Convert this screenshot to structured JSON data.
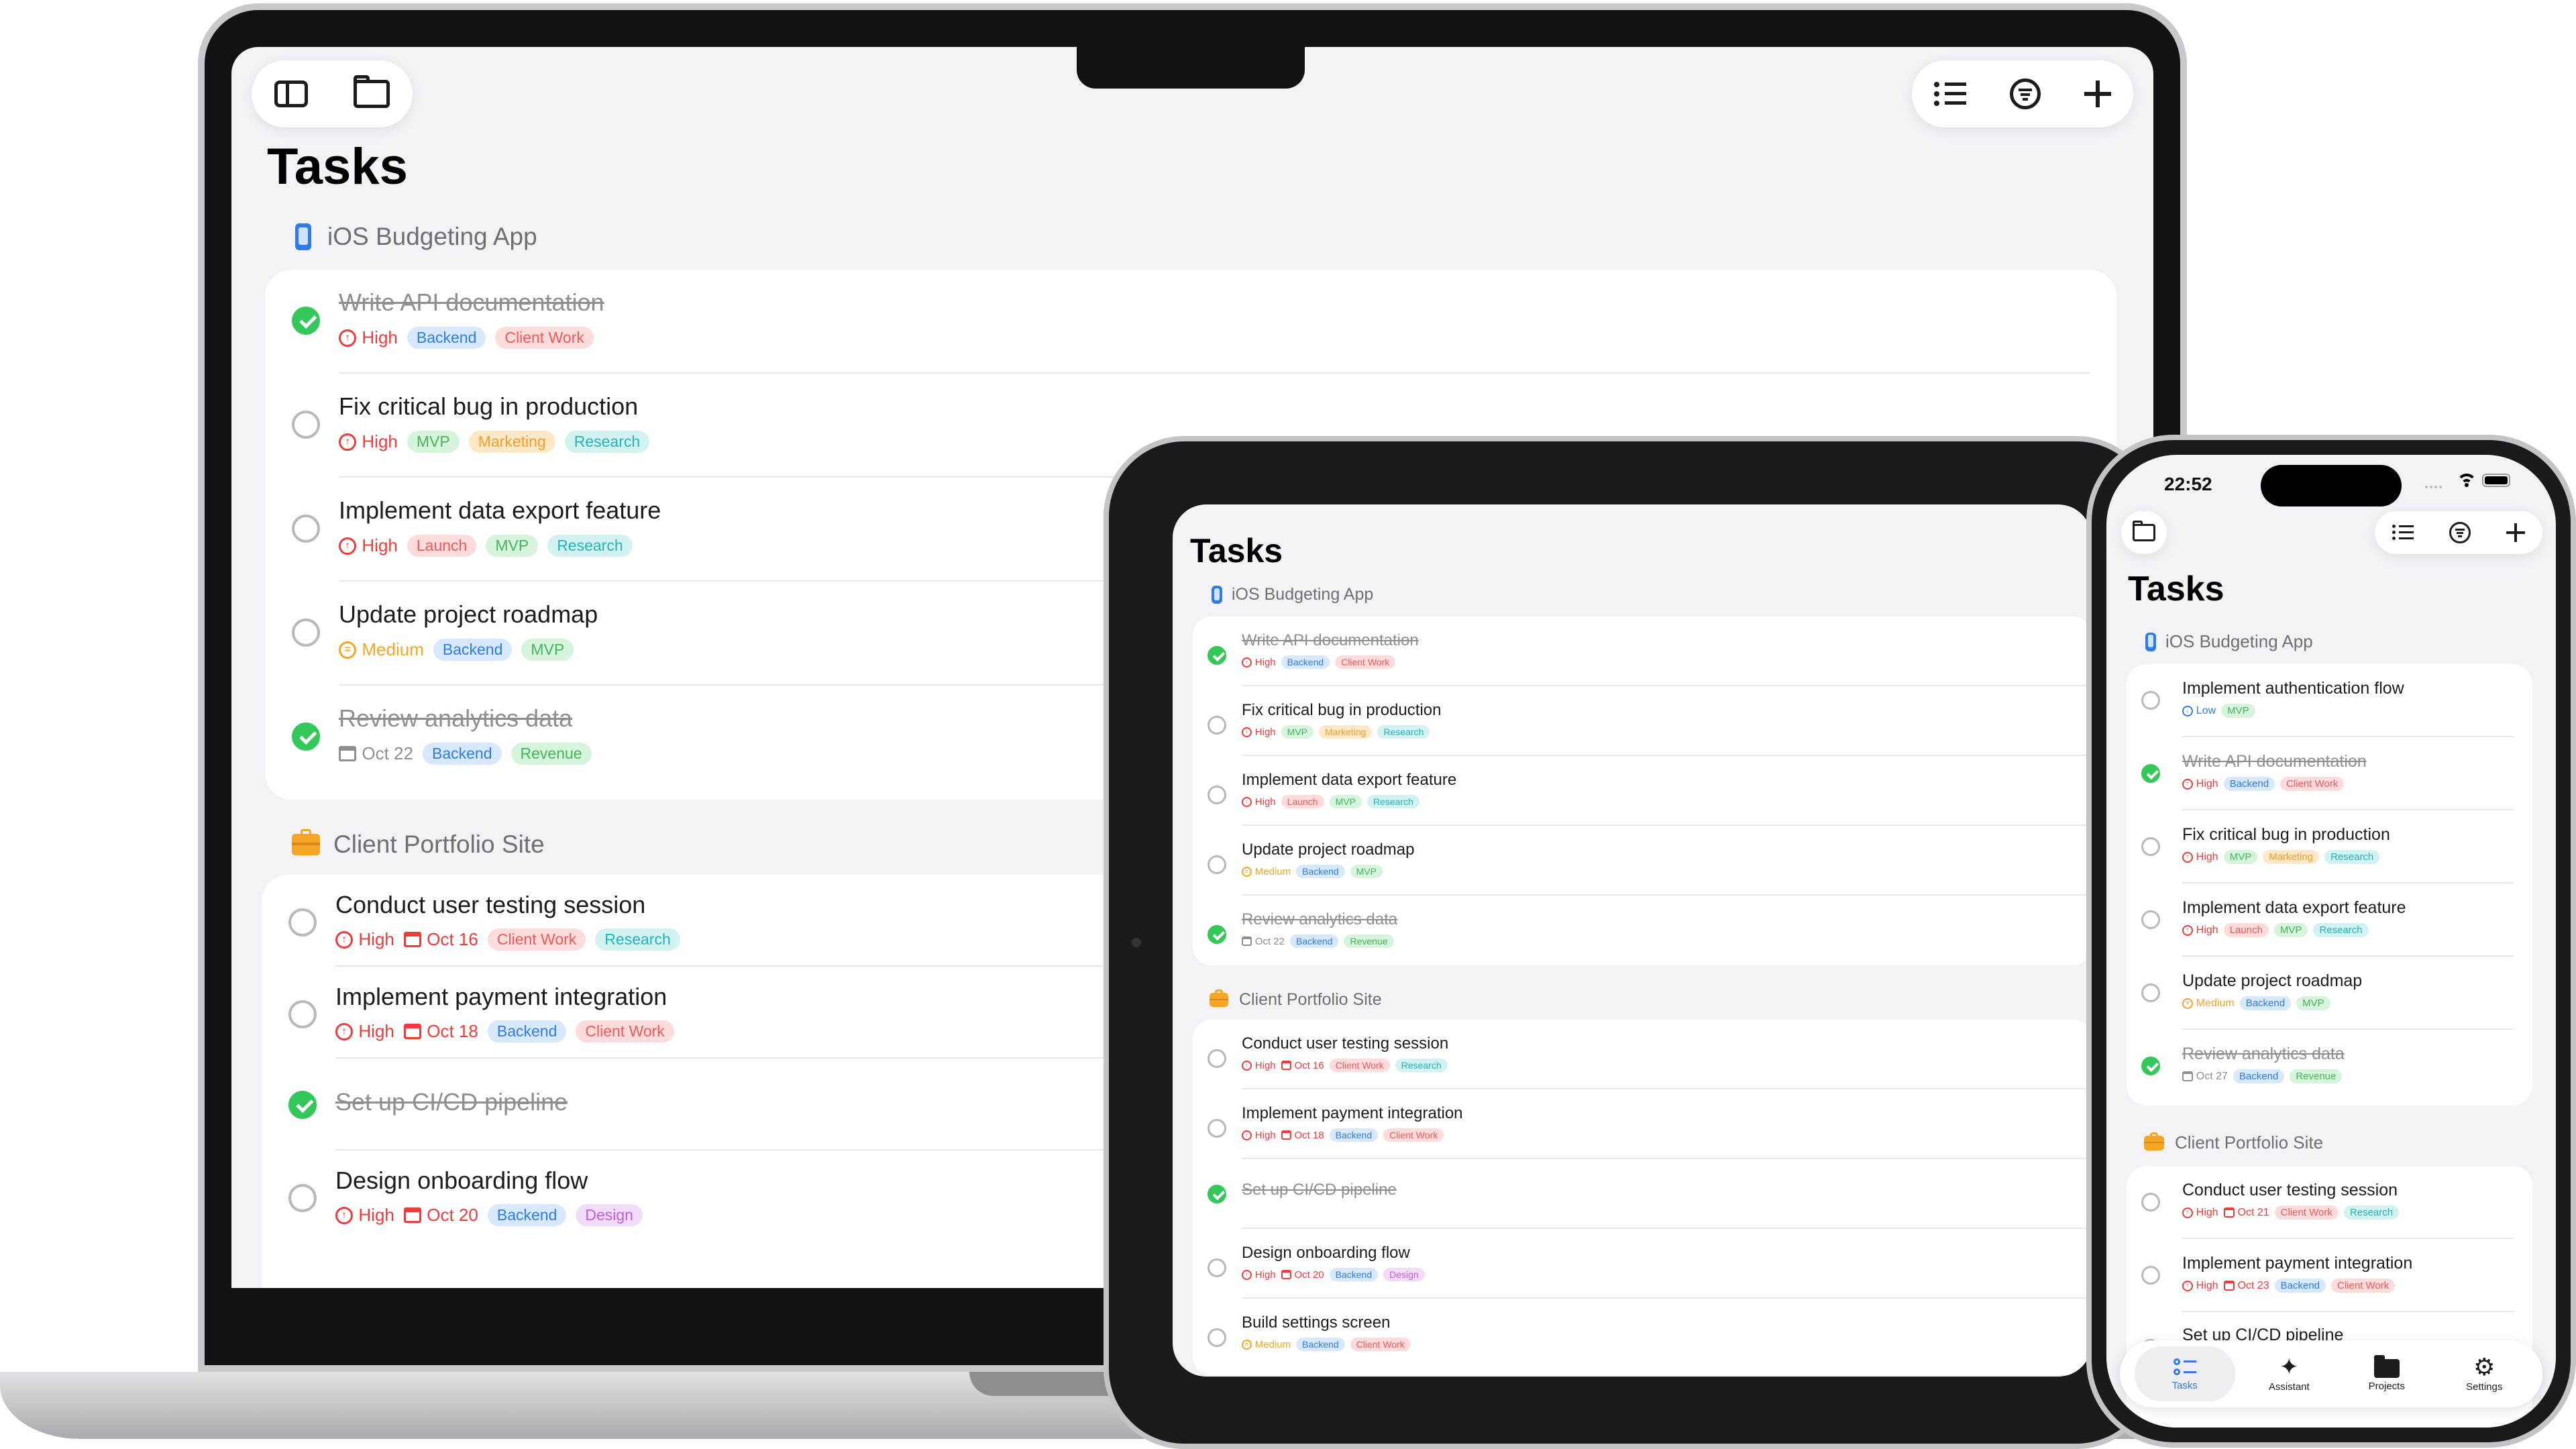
{
  "laptop": {
    "title": "Tasks",
    "toolbar_left": [
      "sidebar-icon",
      "folder-icon"
    ],
    "toolbar_right": [
      "list-icon",
      "filter-icon",
      "plus-icon"
    ],
    "sections": [
      {
        "name": "iOS Budgeting App",
        "tasks": [
          {
            "title": "Write API documentation",
            "done": true,
            "priority": "High",
            "date": "",
            "tags": [
              "Backend",
              "Client Work"
            ]
          },
          {
            "title": "Fix critical bug in production",
            "done": false,
            "priority": "High",
            "date": "",
            "tags": [
              "MVP",
              "Marketing",
              "Research"
            ]
          },
          {
            "title": "Implement data export feature",
            "done": false,
            "priority": "High",
            "date": "",
            "tags": [
              "Launch",
              "MVP",
              "Research"
            ]
          },
          {
            "title": "Update project roadmap",
            "done": false,
            "priority": "Medium",
            "date": "",
            "tags": [
              "Backend",
              "MVP"
            ]
          },
          {
            "title": "Review analytics data",
            "done": true,
            "priority": "",
            "date": "Oct 22",
            "tags": [
              "Backend",
              "Revenue"
            ]
          }
        ]
      },
      {
        "name": "Client Portfolio Site",
        "tasks": [
          {
            "title": "Conduct user testing session",
            "done": false,
            "priority": "High",
            "date": "Oct 16",
            "tags": [
              "Client Work",
              "Research"
            ]
          },
          {
            "title": "Implement payment integration",
            "done": false,
            "priority": "High",
            "date": "Oct 18",
            "tags": [
              "Backend",
              "Client Work"
            ]
          },
          {
            "title": "Set up CI/CD pipeline",
            "done": true,
            "priority": "",
            "date": "",
            "tags": []
          },
          {
            "title": "Design onboarding flow",
            "done": false,
            "priority": "High",
            "date": "Oct 20",
            "tags": [
              "Backend",
              "Design"
            ]
          }
        ]
      }
    ]
  },
  "ipad": {
    "title": "Tasks",
    "sections": [
      {
        "name": "iOS Budgeting App",
        "tasks": [
          {
            "title": "Write API documentation",
            "done": true,
            "priority": "High",
            "date": "",
            "tags": [
              "Backend",
              "Client Work"
            ]
          },
          {
            "title": "Fix critical bug in production",
            "done": false,
            "priority": "High",
            "date": "",
            "tags": [
              "MVP",
              "Marketing",
              "Research"
            ]
          },
          {
            "title": "Implement data export feature",
            "done": false,
            "priority": "High",
            "date": "",
            "tags": [
              "Launch",
              "MVP",
              "Research"
            ]
          },
          {
            "title": "Update project roadmap",
            "done": false,
            "priority": "Medium",
            "date": "",
            "tags": [
              "Backend",
              "MVP"
            ]
          },
          {
            "title": "Review analytics data",
            "done": true,
            "priority": "",
            "date": "Oct 22",
            "tags": [
              "Backend",
              "Revenue"
            ]
          }
        ]
      },
      {
        "name": "Client Portfolio Site",
        "tasks": [
          {
            "title": "Conduct user testing session",
            "done": false,
            "priority": "High",
            "date": "Oct 16",
            "tags": [
              "Client Work",
              "Research"
            ]
          },
          {
            "title": "Implement payment integration",
            "done": false,
            "priority": "High",
            "date": "Oct 18",
            "tags": [
              "Backend",
              "Client Work"
            ]
          },
          {
            "title": "Set up CI/CD pipeline",
            "done": true,
            "priority": "",
            "date": "",
            "tags": []
          },
          {
            "title": "Design onboarding flow",
            "done": false,
            "priority": "High",
            "date": "Oct 20",
            "tags": [
              "Backend",
              "Design"
            ]
          },
          {
            "title": "Build settings screen",
            "done": false,
            "priority": "Medium",
            "date": "",
            "tags": [
              "Backend",
              "Client Work"
            ]
          }
        ]
      }
    ]
  },
  "phone": {
    "time": "22:52",
    "title": "Tasks",
    "sections": [
      {
        "name": "iOS Budgeting App",
        "tasks": [
          {
            "title": "Implement authentication flow",
            "done": false,
            "priority": "Low",
            "date": "",
            "tags": [
              "MVP"
            ]
          },
          {
            "title": "Write API documentation",
            "done": true,
            "priority": "High",
            "date": "",
            "tags": [
              "Backend",
              "Client Work"
            ]
          },
          {
            "title": "Fix critical bug in production",
            "done": false,
            "priority": "High",
            "date": "",
            "tags": [
              "MVP",
              "Marketing",
              "Research"
            ]
          },
          {
            "title": "Implement data export feature",
            "done": false,
            "priority": "High",
            "date": "",
            "tags": [
              "Launch",
              "MVP",
              "Research"
            ]
          },
          {
            "title": "Update project roadmap",
            "done": false,
            "priority": "Medium",
            "date": "",
            "tags": [
              "Backend",
              "MVP"
            ]
          },
          {
            "title": "Review analytics data",
            "done": true,
            "priority": "",
            "date": "Oct 27",
            "tags": [
              "Backend",
              "Revenue"
            ]
          }
        ]
      },
      {
        "name": "Client Portfolio Site",
        "tasks": [
          {
            "title": "Conduct user testing session",
            "done": false,
            "priority": "High",
            "date": "Oct 21",
            "tags": [
              "Client Work",
              "Research"
            ]
          },
          {
            "title": "Implement payment integration",
            "done": false,
            "priority": "High",
            "date": "Oct 23",
            "tags": [
              "Backend",
              "Client Work"
            ]
          },
          {
            "title": "Set up CI/CD pipeline",
            "done": false,
            "priority": "",
            "date": "",
            "tags": []
          }
        ]
      }
    ],
    "tabs": [
      {
        "label": "Tasks",
        "icon": "checklist-icon",
        "active": true
      },
      {
        "label": "Assistant",
        "icon": "sparkle-icon",
        "active": false
      },
      {
        "label": "Projects",
        "icon": "folder-icon",
        "active": false
      },
      {
        "label": "Settings",
        "icon": "gear-icon",
        "active": false
      }
    ]
  },
  "colors": {
    "accent": "#2f7ce8",
    "high": "#ef3b3b",
    "medium": "#f5a623",
    "done": "#34c759",
    "background": "#f2f2f7"
  }
}
